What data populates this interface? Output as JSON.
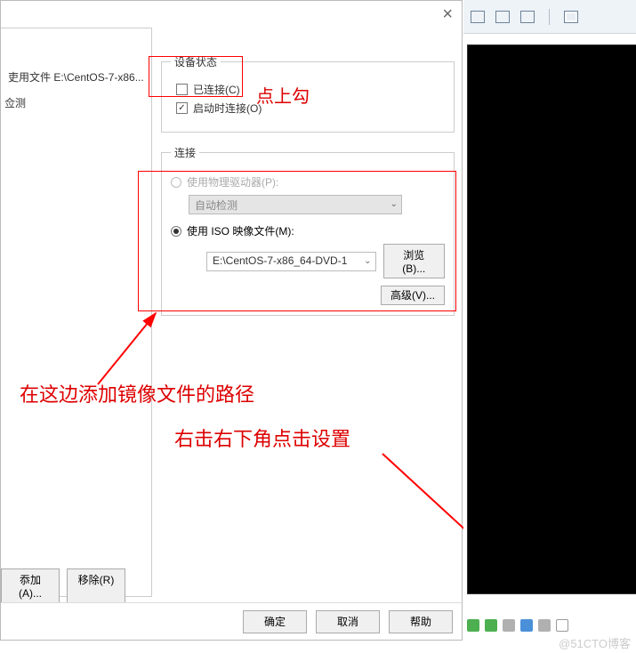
{
  "dialog": {
    "close": "×",
    "left": {
      "file_item": "吏用文件 E:\\CentOS-7-x86...",
      "detect": "佥测"
    },
    "device_status": {
      "legend": "设备状态",
      "connected_label": "已连接(C)",
      "connected_checked": false,
      "connect_on_start_label": "启动时连接(O)",
      "connect_on_start_checked": true
    },
    "connection": {
      "legend": "连接",
      "physical_label": "使用物理驱动器(P):",
      "auto_detect": "自动检测",
      "iso_label": "使用 ISO 映像文件(M):",
      "iso_path": "E:\\CentOS-7-x86_64-DVD-1",
      "browse": "浏览(B)...",
      "advanced": "高级(V)..."
    },
    "left_buttons": {
      "add": "忝加(A)...",
      "remove": "移除(R)"
    },
    "bottom": {
      "ok": "确定",
      "cancel": "取消",
      "help": "帮助"
    }
  },
  "annotations": {
    "check_tip": "点上勾",
    "path_tip": "在这边添加镜像文件的路径",
    "rclick_tip": "右击右下角点击设置"
  },
  "watermark": "@51CTO博客"
}
